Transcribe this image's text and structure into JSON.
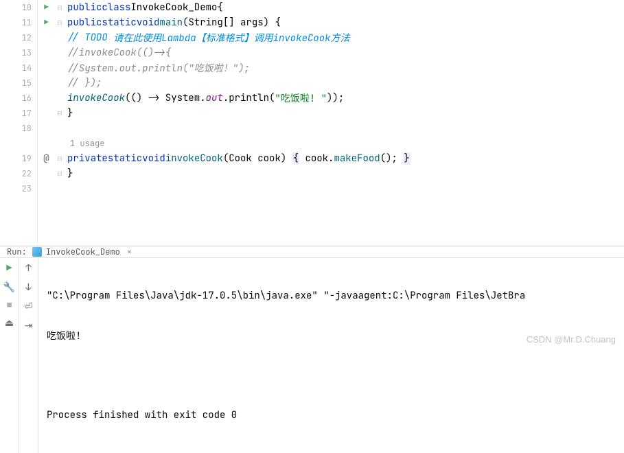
{
  "gutter": {
    "lines": [
      "10",
      "11",
      "12",
      "13",
      "14",
      "15",
      "16",
      "17",
      "18",
      "",
      "19",
      "22",
      "23"
    ]
  },
  "code": {
    "l10": {
      "kw1": "public",
      "kw2": "class",
      "cls": "InvokeCook_Demo",
      "br": "{"
    },
    "l11": {
      "kw1": "public",
      "kw2": "static",
      "kw3": "void",
      "m": "main",
      "p1": "(",
      "t": "String",
      "arr": "[] ",
      "arg": "args",
      "p2": ")",
      "br": " {"
    },
    "l12": {
      "todo_lbl": "// TODO",
      "todo_txt": " 请在此使用Lambda【标准格式】调用invokeCook方法"
    },
    "l13": {
      "c": "//invokeCook(()->{"
    },
    "l14": {
      "c": "//System.out.println(\"吃饭啦！\");"
    },
    "l15": {
      "c": "// });"
    },
    "l16": {
      "m": "invokeCook",
      "p1": "(() -> System.",
      "out": "out",
      "dot": ".println(",
      "s": "\"吃饭啦! \"",
      "p2": "));"
    },
    "l17": {
      "br": "}"
    },
    "usage": "1 usage",
    "l19": {
      "kw1": "private",
      "kw2": "static",
      "kw3": "void",
      "m": "invokeCook",
      "p1": "(",
      "t": "Cook",
      "arg": " cook",
      "p2": ") ",
      "bro": "{",
      "body1": " cook.",
      "mk": "makeFood",
      "body2": "(); ",
      "brc": "}"
    },
    "l22": {
      "br": "}"
    }
  },
  "run": {
    "label": "Run:",
    "tab": "InvokeCook_Demo",
    "close": "×",
    "out1": "\"C:\\Program Files\\Java\\jdk-17.0.5\\bin\\java.exe\" \"-javaagent:C:\\Program Files\\JetBra",
    "out2": "吃饭啦!",
    "out3": "Process finished with exit code 0"
  },
  "watermark": "CSDN @Mr.D.Chuang"
}
